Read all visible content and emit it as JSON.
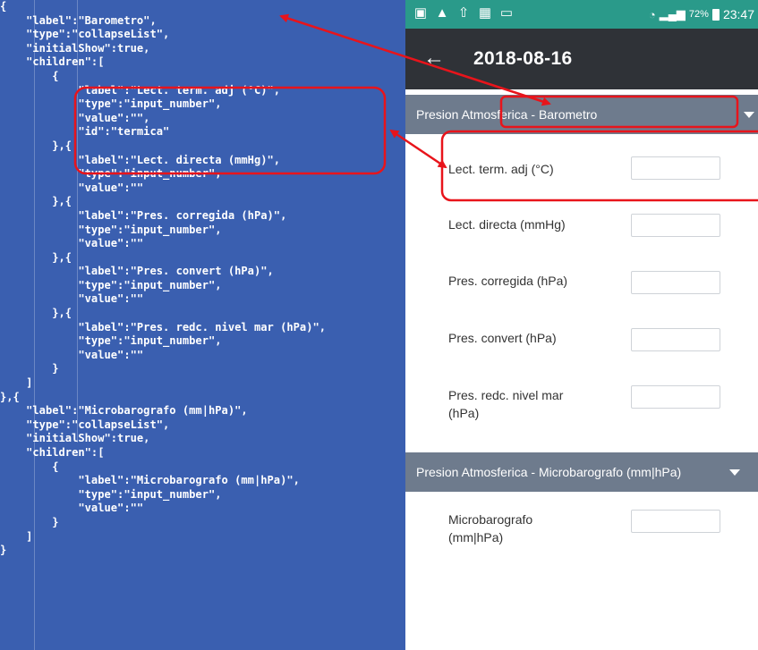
{
  "code_lines": [
    "{",
    "    \"label\":\"Barometro\",",
    "    \"type\":\"collapseList\",",
    "    \"initialShow\":true,",
    "    \"children\":[",
    "        {",
    "            \"label\":\"Lect. term. adj (°C)\",",
    "            \"type\":\"input_number\",",
    "            \"value\":\"\",",
    "            \"id\":\"termica\"",
    "        },{",
    "            \"label\":\"Lect. directa (mmHg)\",",
    "            \"type\":\"input_number\",",
    "            \"value\":\"\"",
    "        },{",
    "            \"label\":\"Pres. corregida (hPa)\",",
    "            \"type\":\"input_number\",",
    "            \"value\":\"\"",
    "        },{",
    "            \"label\":\"Pres. convert (hPa)\",",
    "            \"type\":\"input_number\",",
    "            \"value\":\"\"",
    "        },{",
    "            \"label\":\"Pres. redc. nivel mar (hPa)\",",
    "            \"type\":\"input_number\",",
    "            \"value\":\"\"",
    "        }",
    "    ]",
    "},{",
    "    \"label\":\"Microbarografo (mm|hPa)\",",
    "    \"type\":\"collapseList\",",
    "    \"initialShow\":true,",
    "    \"children\":[",
    "        {",
    "            \"label\":\"Microbarografo (mm|hPa)\",",
    "            \"type\":\"input_number\",",
    "            \"value\":\"\"",
    "        }",
    "    ]",
    "}"
  ],
  "status_bar": {
    "left_icons": [
      "image-icon",
      "warning-icon",
      "upload-icon",
      "gallery-icon",
      "screenshot-icon"
    ],
    "signal": "wifi-icon",
    "battery_percent": "72%",
    "time": "23:47"
  },
  "app_bar": {
    "title": "2018-08-16"
  },
  "sections": [
    {
      "header": "Presion Atmosferica - Barometro",
      "fields": [
        {
          "label": "Lect. term. adj (°C)",
          "value": ""
        },
        {
          "label": "Lect. directa (mmHg)",
          "value": ""
        },
        {
          "label": "Pres. corregida (hPa)",
          "value": ""
        },
        {
          "label": "Pres. convert (hPa)",
          "value": ""
        },
        {
          "label": "Pres. redc. nivel mar (hPa)",
          "value": ""
        }
      ]
    },
    {
      "header": "Presion Atmosferica - Microbarografo (mm|hPa)",
      "fields": [
        {
          "label": "Microbarografo (mm|hPa)",
          "value": ""
        }
      ]
    }
  ],
  "colors": {
    "code_background": "#3a5fb0",
    "status_bar": "#2a9a8a",
    "app_bar": "#2f3237",
    "section_header": "#6e7b8d",
    "annotation": "#e8141b"
  }
}
